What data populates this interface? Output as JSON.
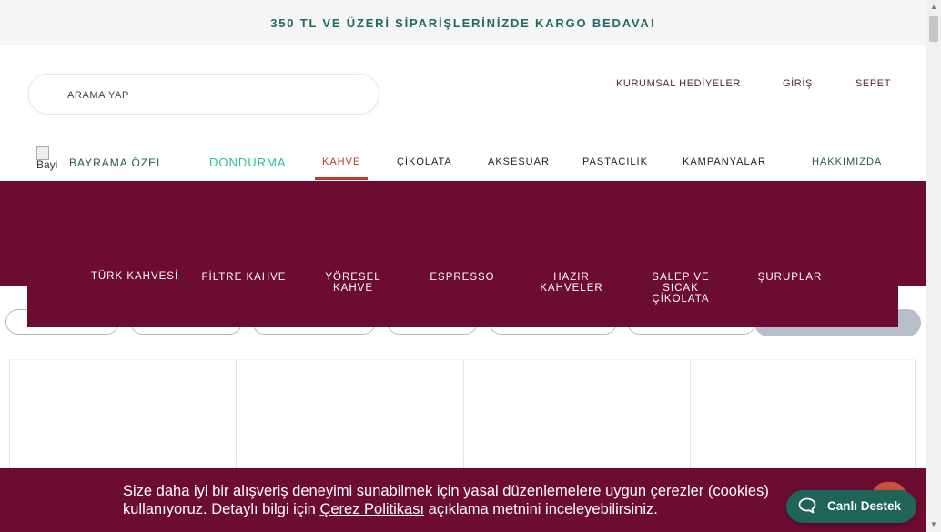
{
  "announcement": "350 TL VE ÜZERİ SİPARİŞLERİNİZDE KARGO BEDAVA!",
  "search": {
    "placeholder": "ARAMA YAP"
  },
  "top_links": {
    "corporate": "KURUMSAL HEDİYELER",
    "login": "GİRİŞ",
    "cart": "SEPET"
  },
  "logo_alt": "Bayi",
  "nav": {
    "bayram": "BAYRAMA ÖZEL",
    "dondurma": "DONDURMA",
    "kahve": "KAHVE",
    "cikolata": "ÇİKOLATA",
    "aksesuar": "AKSESUAR",
    "pastacilik": "PASTACILIK",
    "kampanyalar": "KAMPANYALAR",
    "hakkimizda": "HAKKIMIZDA"
  },
  "submenu": {
    "turk": "TÜRK KAHVESİ",
    "filtre": "FİLTRE KAHVE",
    "yoresel_1": "YÖRESEL",
    "yoresel_2": "KAHVE",
    "espresso": "ESPRESSO",
    "hazir_1": "HAZIR",
    "hazir_2": "KAHVELER",
    "salep_1": "SALEP VE",
    "salep_2": "SICAK",
    "salep_3": "ÇİKOLATA",
    "suruplar": "ŞURUPLAR"
  },
  "cookie": {
    "line1": "Size daha iyi bir alışveriş deneyimi sunabilmek için yasal düzenlemelere uygun çerezler (cookies)",
    "line2_a": "kullanıyoruz. Detaylı bilgi için ",
    "link": "Çerez Politikası",
    "line2_b": " açıklama metnini inceleyebilirsiniz."
  },
  "support_label": "Canlı Destek",
  "colors": {
    "brand": "#6c0c33",
    "teal": "#1f6b64",
    "dondurma": "#2bbfa4",
    "active": "#c0392b",
    "support": "#1e6458"
  },
  "icons": [
    "chat-bubble-icon"
  ]
}
